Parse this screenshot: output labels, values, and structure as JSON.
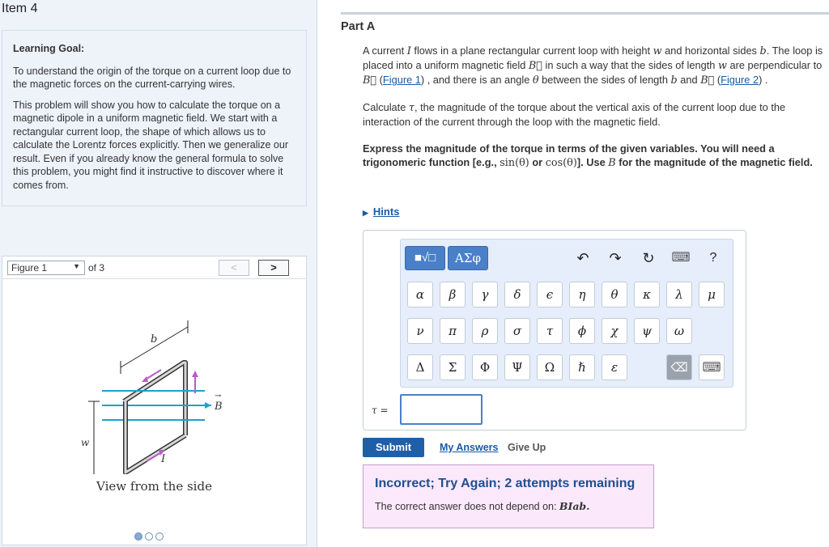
{
  "item_title": "Item 4",
  "learning_goal": {
    "title": "Learning Goal:",
    "para1": "To understand the origin of the torque on a current loop due to the magnetic forces on the current-carrying wires.",
    "para2": "This problem will show you how to calculate the torque on a magnetic dipole in a uniform magnetic field. We start with a rectangular current loop, the shape of which allows us to calculate the Lorentz forces explicitly. Then we generalize our result. Even if you already know the general formula to solve this problem, you might find it instructive to discover where it comes from."
  },
  "figure": {
    "select_value": "Figure 1",
    "of_text": "of 3",
    "prev": "<",
    "next": ">",
    "label_b": "b",
    "label_B": "B",
    "label_w": "w",
    "label_I": "I",
    "caption": "View from the side",
    "pages": 3,
    "current_page": 1
  },
  "part": {
    "title": "Part A",
    "p1": {
      "a": "A current ",
      "I": "I",
      "b": " flows in a plane rectangular current loop with height ",
      "w": "w",
      "c": " and horizontal sides ",
      "bvar": "b",
      "d": ". The loop is placed into a uniform magnetic field ",
      "Bvec": "B⃗",
      "e": " in such a way that the sides of length ",
      "w2": "w",
      "f": " are perpendicular to ",
      "Bvec2": "B⃗",
      "g": " (",
      "fig1": "Figure 1",
      "h": ") , and there is an angle ",
      "theta": "θ",
      "i": " between the sides of length ",
      "b2": "b",
      "j": " and ",
      "Bvec3": "B⃗",
      "k": " (",
      "fig2": "Figure 2",
      "l": ") ."
    },
    "p2": {
      "a": "Calculate ",
      "tau": "τ",
      "b": ", the magnitude of the torque about the vertical axis of the current loop due to the interaction of the current through the loop with the magnetic field."
    },
    "p3": {
      "a": "Express the magnitude of the torque in terms of the given variables. You will need a trigonomeric function [e.g., ",
      "sin": "sin(θ)",
      "b": " or ",
      "cos": "cos(θ)",
      "c": "]. Use ",
      "B": "B",
      "d": " for the magnitude of the magnetic field."
    },
    "hints": "Hints"
  },
  "toolbar": {
    "template_btn": "■√□",
    "greek_btn": "ΑΣφ",
    "undo": "↶",
    "redo": "↷",
    "reset": "↻",
    "keyboard": "⌨",
    "help": "?"
  },
  "keys_row1": [
    "α",
    "β",
    "γ",
    "δ",
    "ϵ",
    "η",
    "θ",
    "κ",
    "λ",
    "μ"
  ],
  "keys_row2": [
    "ν",
    "π",
    "ρ",
    "σ",
    "τ",
    "ϕ",
    "χ",
    "ψ",
    "ω"
  ],
  "keys_row3": [
    "Δ",
    "Σ",
    "Φ",
    "Ψ",
    "Ω",
    "ℏ",
    "ε"
  ],
  "keys_extra": {
    "backspace": "⌫",
    "keyboard2": "⌨"
  },
  "answer": {
    "label": "τ =",
    "value": ""
  },
  "buttons": {
    "submit": "Submit",
    "my_answers": "My Answers",
    "give_up": "Give Up"
  },
  "feedback": {
    "title": "Incorrect; Try Again; 2 attempts remaining",
    "msg": "The correct answer does not depend on: ",
    "vars": "BIab."
  }
}
